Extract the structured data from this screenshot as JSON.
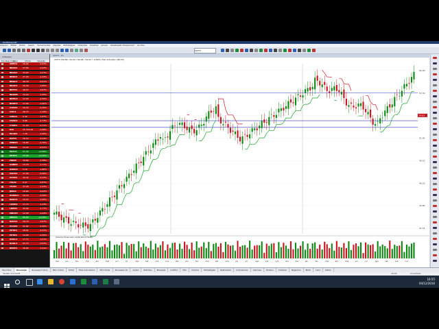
{
  "window": {
    "title": "ProfitChart RT"
  },
  "menu": {
    "items": [
      "Arquivo",
      "Editar",
      "Exibir",
      "Inserir",
      "Ferramentas",
      "Opções",
      "Estratégias",
      "Cotações",
      "Desktop",
      "Janela",
      "Atualização Disponível!",
      "Ao Vivo"
    ]
  },
  "toolbar": {
    "symbol_value": "VIVT3"
  },
  "sidebar": {
    "tabs": [
      "Cotações"
    ],
    "header": [
      "Top Mais Chips",
      "Ativo",
      "Último",
      "Variação"
    ],
    "colors": {
      "up": "#0a7a12",
      "down": "#b70e0e",
      "up_strong": "#1aa42a"
    },
    "rows": [
      {
        "symbol": "ABEV3",
        "price": "16,44",
        "change": "-0,54%",
        "trend": "down"
      },
      {
        "symbol": "BBAS3",
        "price": "27,89",
        "change": "-0,93%",
        "trend": "down"
      },
      {
        "symbol": "BBAS3",
        "price": "33,63",
        "change": "-1,07%",
        "trend": "down"
      },
      {
        "symbol": "BBDC4",
        "price": "27,29",
        "change": "-1,24%",
        "trend": "down"
      },
      {
        "symbol": "BBDC3",
        "price": "26,78",
        "change": "-0,51%",
        "trend": "down"
      },
      {
        "symbol": "BRAP4",
        "price": "16,39",
        "change": "-1,85%",
        "trend": "down"
      },
      {
        "symbol": "BRFS3",
        "price": "36,57",
        "change": "-0,67%",
        "trend": "down"
      },
      {
        "symbol": "BRKM5",
        "price": "33,20",
        "change": "-1,45%",
        "trend": "down"
      },
      {
        "symbol": "BRML3",
        "price": "12,03",
        "change": "-2,59%",
        "trend": "down"
      },
      {
        "symbol": "BVMF3",
        "price": "17,09",
        "change": "-1,90%",
        "trend": "down"
      },
      {
        "symbol": "CCRO3",
        "price": "16,33",
        "change": "-0,30%",
        "trend": "down"
      },
      {
        "symbol": "CIEL3",
        "price": "26,77",
        "change": "-1,19%",
        "trend": "down"
      },
      {
        "symbol": "CMIG4",
        "price": "9,49",
        "change": "-1,87%",
        "trend": "down"
      },
      {
        "symbol": "CSNA3",
        "price": "9,98",
        "change": "-2,73%",
        "trend": "down"
      },
      {
        "symbol": "CYRE3",
        "price": "11,20",
        "change": "-0,71%",
        "trend": "down"
      },
      {
        "symbol": "DIX",
        "price": "25 145,49",
        "change": "-0,88%",
        "trend": "down"
      },
      {
        "symbol": "ECOR3",
        "price": "7,78",
        "change": "-2,26%",
        "trend": "down"
      },
      {
        "symbol": "ELET3",
        "price": "16,70",
        "change": "-0,24%",
        "trend": "down"
      },
      {
        "symbol": "EMBR3",
        "price": "16,85",
        "change": "-0,76%",
        "trend": "down"
      },
      {
        "symbol": "ENBR3",
        "price": "15,03",
        "change": "-0,52%",
        "trend": "down"
      },
      {
        "symbol": "EQTL3",
        "price": "57,34",
        "change": "+0,66%",
        "trend": "up"
      },
      {
        "symbol": "ESTC3",
        "price": "25,66",
        "change": "+1,20%",
        "trend": "up_strong"
      },
      {
        "symbol": "FIBR3",
        "price": "30,60",
        "change": "-1,38%",
        "trend": "down"
      },
      {
        "symbol": "GGBR4",
        "price": "13,76",
        "change": "-1,71%",
        "trend": "down"
      },
      {
        "symbol": "GOAU4",
        "price": "5,79",
        "change": "-1,86%",
        "trend": "down"
      },
      {
        "symbol": "HGTX3",
        "price": "27,99",
        "change": "-0,96%",
        "trend": "down"
      },
      {
        "symbol": "HYPE3",
        "price": "30,32",
        "change": "-0,33%",
        "trend": "down"
      },
      {
        "symbol": "ITSA4",
        "price": "9,47",
        "change": "-0,87%",
        "trend": "down"
      },
      {
        "symbol": "ITUB4",
        "price": "37,28",
        "change": "-1,43%",
        "trend": "down"
      },
      {
        "symbol": "JBSS3",
        "price": "10,66",
        "change": "-2,02%",
        "trend": "down"
      },
      {
        "symbol": "KLBN11",
        "price": "16,16",
        "change": "-0,49%",
        "trend": "down"
      },
      {
        "symbol": "KROT3",
        "price": "15,07",
        "change": "-1,05%",
        "trend": "down"
      },
      {
        "symbol": "LAME4",
        "price": "17,73",
        "change": "-1,23%",
        "trend": "down"
      },
      {
        "symbol": "LREN3",
        "price": "30,09",
        "change": "-1,77%",
        "trend": "down"
      },
      {
        "symbol": "MRVE3",
        "price": "12,58",
        "change": "-1,04%",
        "trend": "down"
      },
      {
        "symbol": "MULT3",
        "price": "68,66",
        "change": "+0,28%",
        "trend": "up_strong"
      },
      {
        "symbol": "NATU3",
        "price": "29,74",
        "change": "-0,67%",
        "trend": "down"
      },
      {
        "symbol": "PCAR4",
        "price": "52,94",
        "change": "-0,40%",
        "trend": "down"
      },
      {
        "symbol": "PETR3",
        "price": "16,41",
        "change": "-0,91%",
        "trend": "down"
      },
      {
        "symbol": "PETR4",
        "price": "14,58",
        "change": "-1,55%",
        "trend": "down"
      },
      {
        "symbol": "QUAL3",
        "price": "17,71",
        "change": "-1,01%",
        "trend": "down"
      },
      {
        "symbol": "RADL3",
        "price": "63,70",
        "change": "-0,63%",
        "trend": "down"
      },
      {
        "symbol": "RENT3",
        "price": "36,85",
        "change": "-1,31%",
        "trend": "down"
      }
    ]
  },
  "chart": {
    "tab_label": "VIVT3 - 15",
    "info": "VIVT3 (59,58 / 52,94 / 60,08 / 54,63 / -0,89%)  Hilo Activator (48,70)",
    "volume_label": "Volume Financeiro (218.404.576,00)",
    "price_ticks": [
      "60,00",
      "57,30",
      "54,61",
      "51,92",
      "49,22",
      "46,53",
      "43,84",
      "41,14"
    ],
    "last_price": "54,63",
    "month_labels": [
      "dez",
      "jan",
      "fev",
      "mar",
      "abr",
      "mai",
      "jun",
      "jul",
      "ago",
      "set",
      "out",
      "nov",
      "dez",
      "jan",
      "fev",
      "mar",
      "abr",
      "mai",
      "jun",
      "jul",
      "ago",
      "set",
      "out",
      "nov",
      "dez",
      "jan",
      "fev",
      "mar",
      "abr",
      "mai",
      "jun",
      "jul",
      "ago",
      "set",
      "out",
      "nov"
    ],
    "colors": {
      "up": "#0b8a12",
      "down": "#c8141e",
      "hilo": "#1aa42a",
      "hilo_down": "#d9121b",
      "level": "#3333cc",
      "bg": "#ffffff"
    }
  },
  "bottom_tabs": {
    "items": [
      "Favoritos",
      "Ibovespa",
      "Ibovespa Futuro",
      "Mini Índice",
      "Dólar",
      "Eles Calculados",
      "Mini Dólar",
      "Ibovespa (2)",
      "Ações",
      "Petróleo",
      "Bovespa",
      "Gráfico",
      "Hilo",
      "Volume",
      "Estratégias",
      "Rastreador",
      "Indicadores",
      "Alarmes",
      "Ordens",
      "Carteira",
      "Negócios",
      "Book",
      "Livro",
      "Rádio"
    ],
    "active_index": 1
  },
  "statusbar": {
    "left": "Versão 4.0.0.224",
    "center": "Conectado",
    "time": "16:04"
  },
  "taskbar": {
    "clock_time": "16:55",
    "clock_date": "04/12/2016"
  }
}
